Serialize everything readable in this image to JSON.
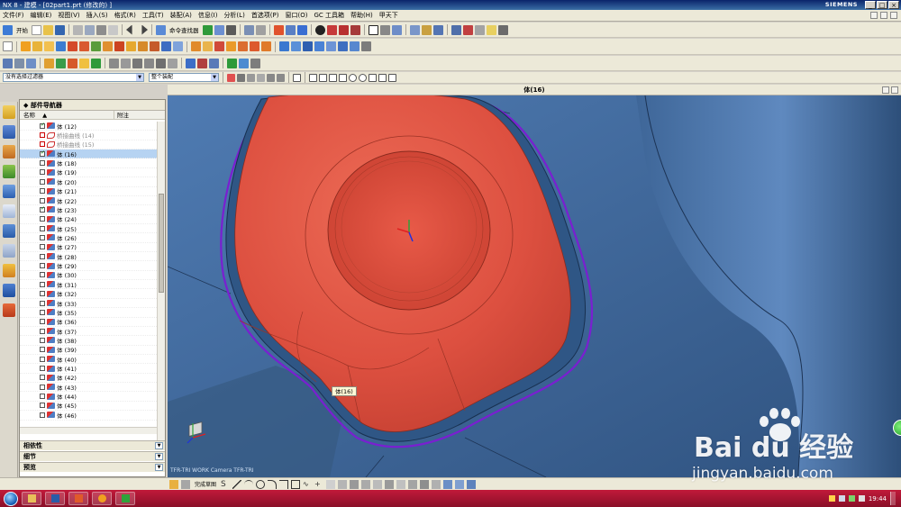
{
  "window": {
    "title": "NX 8 - 建模 - [02part1.prt  (修改的) ]",
    "brand": "SIEMENS",
    "controls": [
      "_",
      "□",
      "×"
    ]
  },
  "menu": [
    "文件(F)",
    "编辑(E)",
    "视图(V)",
    "插入(S)",
    "格式(R)",
    "工具(T)",
    "装配(A)",
    "信息(I)",
    "分析(L)",
    "首选项(P)",
    "窗口(O)",
    "GC 工具箱",
    "帮助(H)",
    "甲天下"
  ],
  "toolbar1": {
    "start_label": "开始",
    "command_finder_label": "命令查找器"
  },
  "selection_bar": {
    "filter_value": "没有选择过滤器",
    "scope_value": "整个装配"
  },
  "viewport": {
    "title": "体(16)",
    "tooltip": "体(16)",
    "view_info": "TFR-TRI WORK Camera TFR-TRI",
    "colors": {
      "part_red": "#e05545",
      "surface_blue": "#3f6a9e",
      "edge_purple": "#7a1fd1"
    }
  },
  "navigator": {
    "title": "部件导航器",
    "col_name": "名称",
    "col_note": "附注",
    "rows": [
      {
        "label": "体 (12)",
        "checked": true,
        "icon": "body"
      },
      {
        "label": "桥接曲线 (14)",
        "checked": false,
        "icon": "curve",
        "dim": true
      },
      {
        "label": "桥接曲线 (15)",
        "checked": false,
        "icon": "curve",
        "dim": true
      },
      {
        "label": "体 (16)",
        "checked": true,
        "icon": "body",
        "selected": true
      },
      {
        "label": "体 (18)",
        "checked": false,
        "icon": "body"
      },
      {
        "label": "体 (19)",
        "checked": false,
        "icon": "body"
      },
      {
        "label": "体 (20)",
        "checked": false,
        "icon": "body"
      },
      {
        "label": "体 (21)",
        "checked": false,
        "icon": "body"
      },
      {
        "label": "体 (22)",
        "checked": false,
        "icon": "body"
      },
      {
        "label": "体 (23)",
        "checked": true,
        "icon": "body"
      },
      {
        "label": "体 (24)",
        "checked": false,
        "icon": "body"
      },
      {
        "label": "体 (25)",
        "checked": false,
        "icon": "body"
      },
      {
        "label": "体 (26)",
        "checked": false,
        "icon": "body"
      },
      {
        "label": "体 (27)",
        "checked": false,
        "icon": "body"
      },
      {
        "label": "体 (28)",
        "checked": false,
        "icon": "body"
      },
      {
        "label": "体 (29)",
        "checked": false,
        "icon": "body"
      },
      {
        "label": "体 (30)",
        "checked": false,
        "icon": "body"
      },
      {
        "label": "体 (31)",
        "checked": false,
        "icon": "body"
      },
      {
        "label": "体 (32)",
        "checked": false,
        "icon": "body"
      },
      {
        "label": "体 (33)",
        "checked": false,
        "icon": "body"
      },
      {
        "label": "体 (35)",
        "checked": false,
        "icon": "body"
      },
      {
        "label": "体 (36)",
        "checked": false,
        "icon": "body"
      },
      {
        "label": "体 (37)",
        "checked": false,
        "icon": "body"
      },
      {
        "label": "体 (38)",
        "checked": false,
        "icon": "body"
      },
      {
        "label": "体 (39)",
        "checked": false,
        "icon": "body"
      },
      {
        "label": "体 (40)",
        "checked": false,
        "icon": "body"
      },
      {
        "label": "体 (41)",
        "checked": false,
        "icon": "body"
      },
      {
        "label": "体 (42)",
        "checked": false,
        "icon": "body"
      },
      {
        "label": "体 (43)",
        "checked": false,
        "icon": "body"
      },
      {
        "label": "体 (44)",
        "checked": false,
        "icon": "body"
      },
      {
        "label": "体 (45)",
        "checked": false,
        "icon": "body"
      },
      {
        "label": "体 (46)",
        "checked": false,
        "icon": "body"
      }
    ],
    "panels": [
      "相依性",
      "细节",
      "预览"
    ]
  },
  "bottom_toolbar": {
    "finish_sketch_label": "完成草图"
  },
  "taskbar": {
    "clock": "19:44"
  },
  "watermark": {
    "brand": "Bai du 经验",
    "url": "jingyan.baidu.com"
  }
}
